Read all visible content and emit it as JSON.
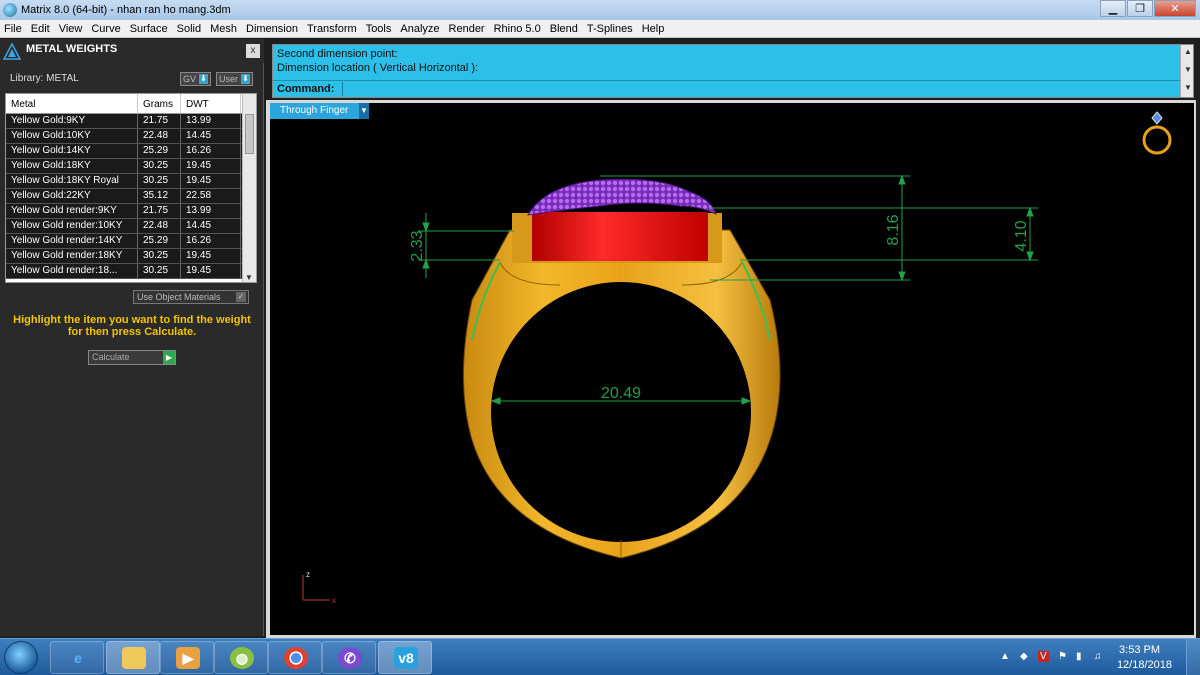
{
  "window": {
    "title": "Matrix 8.0 (64-bit) - nhan ran ho mang.3dm",
    "minimize": "▁",
    "restore": "❐",
    "close": "✕"
  },
  "menu": [
    "File",
    "Edit",
    "View",
    "Curve",
    "Surface",
    "Solid",
    "Mesh",
    "Dimension",
    "Transform",
    "Tools",
    "Analyze",
    "Render",
    "Rhino 5.0",
    "Blend",
    "T-Splines",
    "Help"
  ],
  "panel": {
    "title": "METAL WEIGHTS",
    "close": "x",
    "library_label": "Library: METAL",
    "gv_label": "GV",
    "user_label": "User",
    "columns": [
      "Metal",
      "Grams",
      "DWT"
    ],
    "rows": [
      [
        "Yellow Gold:9KY",
        "21.75",
        "13.99"
      ],
      [
        "Yellow Gold:10KY",
        "22.48",
        "14.45"
      ],
      [
        "Yellow Gold:14KY",
        "25.29",
        "16.26"
      ],
      [
        "Yellow Gold:18KY",
        "30.25",
        "19.45"
      ],
      [
        "Yellow Gold:18KY Royal",
        "30.25",
        "19.45"
      ],
      [
        "Yellow Gold:22KY",
        "35.12",
        "22.58"
      ],
      [
        "Yellow Gold render:9KY",
        "21.75",
        "13.99"
      ],
      [
        "Yellow Gold render:10KY",
        "22.48",
        "14.45"
      ],
      [
        "Yellow Gold render:14KY",
        "25.29",
        "16.26"
      ],
      [
        "Yellow Gold render:18KY",
        "30.25",
        "19.45"
      ],
      [
        "Yellow Gold render:18...",
        "30.25",
        "19.45"
      ]
    ],
    "use_object_materials": "Use Object Materials",
    "hint": "Highlight the item you want to find the weight for then press Calculate.",
    "calculate": "Calculate"
  },
  "command": {
    "line1": "Second dimension point:",
    "line2": "Dimension location ( Vertical  Horizontal ):",
    "label": "Command:"
  },
  "viewport": {
    "tab": "Through Finger",
    "dimensions": {
      "inner_diameter": "20.49",
      "total_height": "8.16",
      "bezel_height": "4.10",
      "side_height": "2.33"
    },
    "axis_z": "z",
    "axis_x": "x",
    "colors": {
      "gold": "#e8a21a",
      "stone": "#e81818",
      "snake": "#9b3fd6",
      "dimension": "#22a04a"
    }
  },
  "taskbar": {
    "time": "3:53 PM",
    "date": "12/18/2018",
    "apps": [
      "ie-icon",
      "folder-icon",
      "media-player-icon",
      "app-icon",
      "chrome-icon",
      "viber-icon",
      "v8-icon"
    ],
    "v8_label": "v8"
  }
}
